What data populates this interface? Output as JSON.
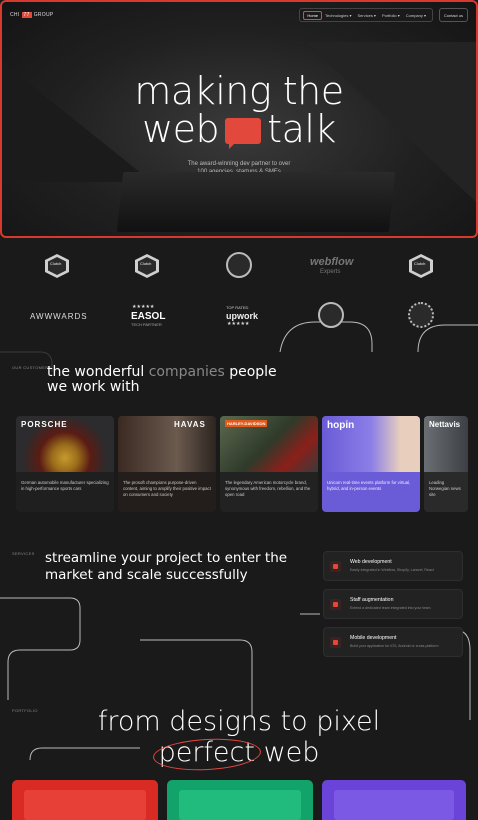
{
  "nav": {
    "logo_left": "CHI",
    "logo_box": "77",
    "logo_right": "GROUP",
    "items": [
      "Home",
      "Technologies ▾",
      "Services ▾",
      "Portfolio ▾",
      "Company ▾"
    ],
    "contact": "Contact us"
  },
  "hero": {
    "title_line1": "making the",
    "title_word_left": "web",
    "title_word_right": "talk",
    "subtitle_line1": "The award-winning dev partner to over",
    "subtitle_line2": "100 agencies, startups & SMEs"
  },
  "awards": {
    "clutch1": "Clutch",
    "clutch2": "Clutch",
    "clutch3": "Clutch",
    "webflow": "webflow",
    "webflow_sub": "Experts",
    "awwwards": "AWWWARDS",
    "easol_stars": "★★★★★",
    "easol": "EASOL",
    "easol_sub": "TECH PARTNER",
    "upwork_top": "TOP RATED",
    "upwork": "upwork",
    "upwork_stars": "★★★★★"
  },
  "customers": {
    "label": "OUR CUSTOMERS",
    "title_part1": "the wonderful ",
    "title_dim": "companies",
    "title_part2": " people",
    "title_line2": "we work with",
    "cards": [
      {
        "brand": "PORSCHE",
        "desc": "German automobile manufacturer specializing in high-performance sports cars"
      },
      {
        "brand": "HAVAS",
        "desc": "The prosoft champions purpose-driven content, aiming to amplify their positive impact on consumers and society"
      },
      {
        "brand": "HARLEY-DAVIDSON",
        "desc": "The legendary American motorcycle brand, synonymous with freedom, rebellion, and the open road"
      },
      {
        "brand": "hopin",
        "desc": "Unicorn real-time events platform for virtual, hybrid, and in-person events"
      },
      {
        "brand": "Nettavis",
        "desc": "Leading Norwegian news site"
      }
    ]
  },
  "services": {
    "label": "SERVICES",
    "title_line1": "streamline your project to enter the",
    "title_line2": "market and scale successfully",
    "items": [
      {
        "name": "Web development",
        "sub": "Easily integrated in Webflow, Shopify, Laravel, React"
      },
      {
        "name": "Staff augmentation",
        "sub": "Extend a dedicated team integrated into your team"
      },
      {
        "name": "Mobile development",
        "sub": "Build your application for iOS, Android or cross-platform"
      }
    ]
  },
  "portfolio": {
    "label": "PORTFOLIO",
    "title_line1": "from designs to pixel",
    "title_ring": "perfect",
    "title_end": " web"
  },
  "colors": {
    "accent": "#e3483c",
    "bg": "#1a1a1b"
  }
}
